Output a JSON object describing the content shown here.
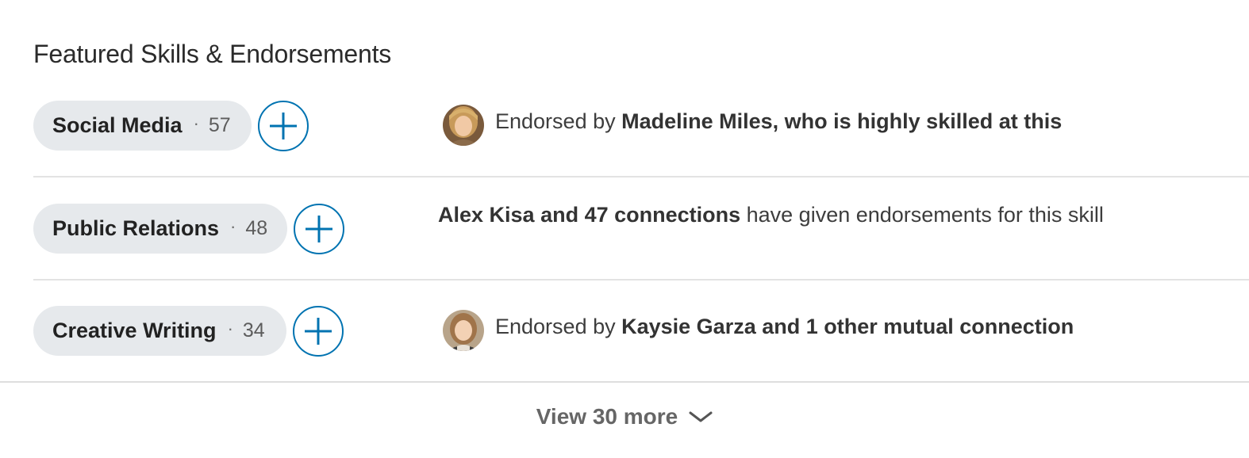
{
  "section": {
    "title": "Featured Skills & Endorsements"
  },
  "skills": [
    {
      "name": "Social Media",
      "separator": "·",
      "count": "57",
      "has_avatar": true,
      "endorse_prefix": "Endorsed by ",
      "endorse_bold": "Madeline Miles, who is highly skilled at this",
      "endorse_suffix": ""
    },
    {
      "name": "Public Relations",
      "separator": "·",
      "count": "48",
      "has_avatar": false,
      "endorse_prefix": "",
      "endorse_bold": "Alex Kisa and 47 connections",
      "endorse_suffix": " have given endorsements for this skill"
    },
    {
      "name": "Creative Writing",
      "separator": "·",
      "count": "34",
      "has_avatar": true,
      "endorse_prefix": "Endorsed by ",
      "endorse_bold": "Kaysie Garza and 1 other mutual connection",
      "endorse_suffix": ""
    }
  ],
  "view_more": {
    "label": "View 30 more"
  },
  "colors": {
    "accent": "#0073b1",
    "pill_bg": "#e6e9ec",
    "divider": "#e3e3e3"
  },
  "icons": {
    "add": "plus-icon",
    "expand": "chevron-down-icon"
  }
}
